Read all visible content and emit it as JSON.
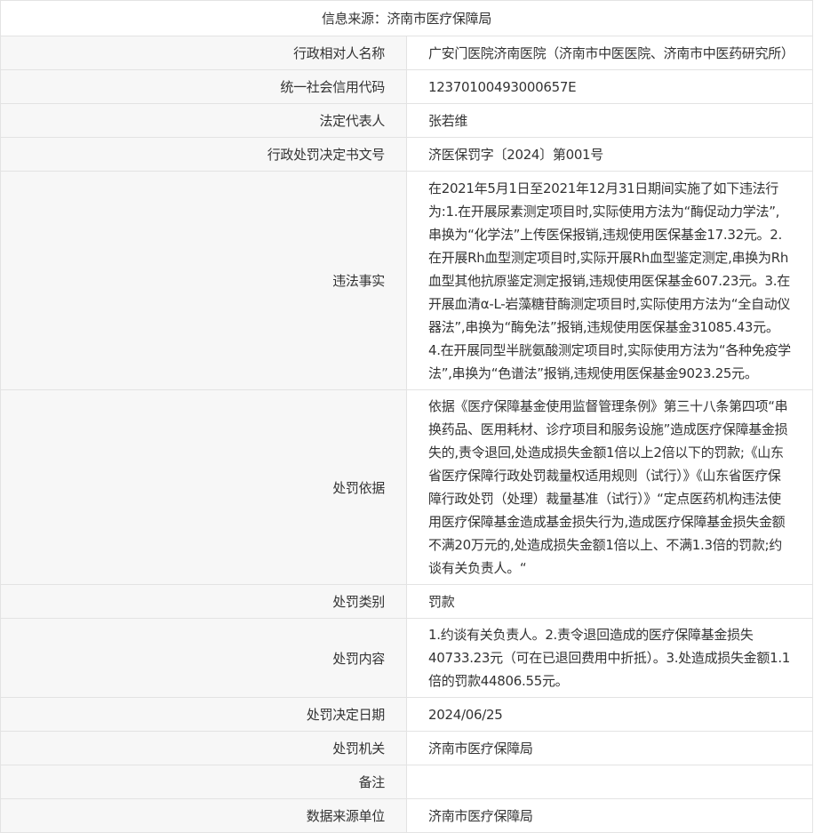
{
  "header": {
    "source": "信息来源：济南市医疗保障局"
  },
  "rows": [
    {
      "label": "行政相对人名称",
      "value": "广安门医院济南医院（济南市中医医院、济南市中医药研究所）"
    },
    {
      "label": "统一社会信用代码",
      "value": "12370100493000657E"
    },
    {
      "label": "法定代表人",
      "value": "张若维"
    },
    {
      "label": "行政处罚决定书文号",
      "value": "济医保罚字〔2024〕第001号"
    },
    {
      "label": "违法事实",
      "value": "在2021年5月1日至2021年12月31日期间实施了如下违法行为:1.在开展尿素测定项目时,实际使用方法为“酶促动力学法”,串换为“化学法”上传医保报销,违规使用医保基金17.32元。2.在开展Rh血型测定项目时,实际开展Rh血型鉴定测定,串换为Rh血型其他抗原鉴定测定报销,违规使用医保基金607.23元。3.在开展血清α-L-岩藻糖苷酶测定项目时,实际使用方法为“全自动仪器法”,串换为“酶免法”报销,违规使用医保基金31085.43元。4.在开展同型半胱氨酸测定项目时,实际使用方法为“各种免疫学法”,串换为“色谱法”报销,违规使用医保基金9023.25元。"
    },
    {
      "label": "处罚依据",
      "value": "依据《医疗保障基金使用监督管理条例》第三十八条第四项“串换药品、医用耗材、诊疗项目和服务设施”造成医疗保障基金损失的,责令退回,处造成损失金额1倍以上2倍以下的罚款;《山东省医疗保障行政处罚裁量权适用规则（试行）》《山东省医疗保障行政处罚（处理）裁量基准（试行）》“定点医药机构违法使用医疗保障基金造成基金损失行为,造成医疗保障基金损失金额不满20万元的,处造成损失金额1倍以上、不满1.3倍的罚款;约谈有关负责人。“"
    },
    {
      "label": "处罚类别",
      "value": "罚款"
    },
    {
      "label": "处罚内容",
      "value": "1.约谈有关负责人。2.责令退回造成的医疗保障基金损失40733.23元（可在已退回费用中折抵）。3.处造成损失金额1.1倍的罚款44806.55元。"
    },
    {
      "label": "处罚决定日期",
      "value": "2024/06/25"
    },
    {
      "label": "处罚机关",
      "value": "济南市医疗保障局"
    },
    {
      "label": "备注",
      "value": ""
    },
    {
      "label": "数据来源单位",
      "value": "济南市医疗保障局"
    }
  ]
}
